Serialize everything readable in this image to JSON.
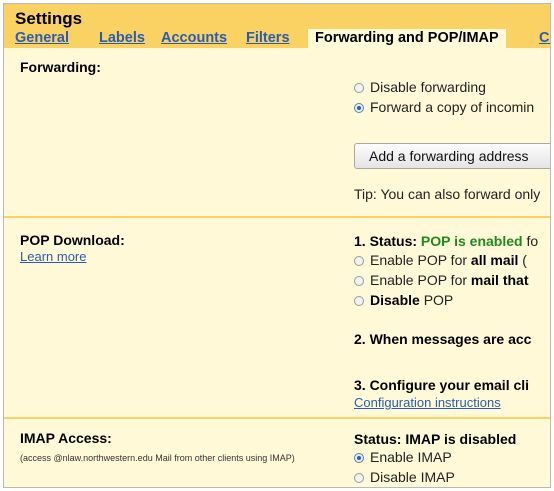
{
  "header": {
    "title": "Settings"
  },
  "tabs": [
    {
      "label": "General"
    },
    {
      "label": "Labels"
    },
    {
      "label": "Accounts"
    },
    {
      "label": "Filters"
    },
    {
      "label": "Forwarding and POP/IMAP"
    },
    {
      "label": "Ch"
    }
  ],
  "forwarding": {
    "label": "Forwarding:",
    "options": [
      {
        "label": "Disable forwarding",
        "selected": false
      },
      {
        "label": "Forward a copy of incomin",
        "selected": true
      }
    ],
    "button_label": "Add a forwarding address",
    "tip": "Tip: You can also forward only"
  },
  "pop": {
    "label": "POP Download:",
    "learn_more": "Learn more",
    "status_prefix": "1. Status: ",
    "status_value": "POP is enabled",
    "status_suffix": " fo",
    "options": [
      {
        "prefix": "Enable POP for ",
        "bold": "all mail",
        "suffix": " (",
        "selected": false
      },
      {
        "prefix": "Enable POP for ",
        "bold": "mail that",
        "suffix": "",
        "selected": false
      },
      {
        "prefix": "",
        "bold": "Disable",
        "suffix": " POP",
        "selected": false
      }
    ],
    "step2": "2. When messages are acc",
    "step3": "3. Configure your email cli",
    "config_link": "Configuration instructions"
  },
  "imap": {
    "label": "IMAP Access:",
    "note": "(access @nlaw.northwestern.edu Mail from other clients using IMAP)",
    "status": "Status: IMAP is disabled",
    "options": [
      {
        "label": "Enable IMAP",
        "selected": true
      },
      {
        "label": "Disable IMAP",
        "selected": false
      }
    ]
  },
  "colors": {
    "header_bg": "#fad163",
    "panel_bg": "#fff9d7",
    "link": "#2a5db0",
    "status_green": "#1e8a1e"
  }
}
